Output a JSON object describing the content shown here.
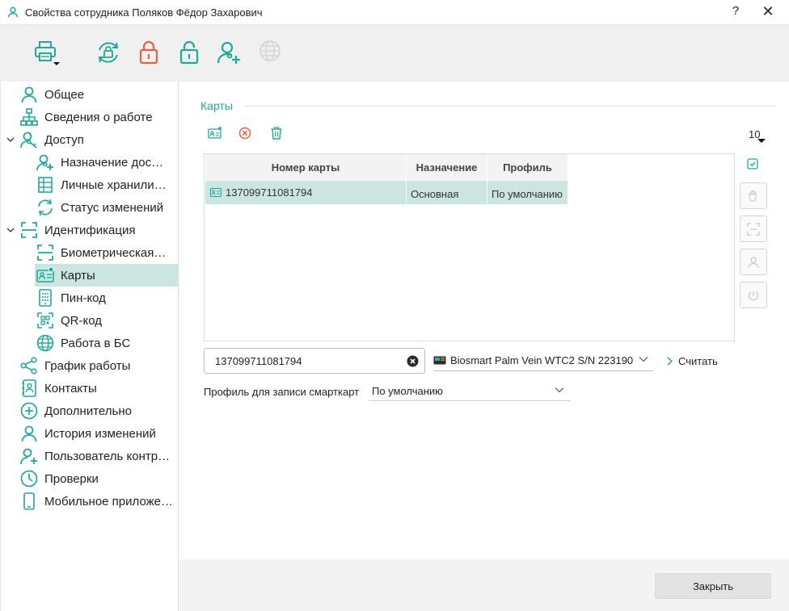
{
  "window": {
    "title": "Свойства сотрудника Поляков Фёдор Захарович",
    "help": "?",
    "close": "✕"
  },
  "colors": {
    "accent": "#1fa99b",
    "danger": "#e8603c",
    "selection": "#cbe6e1"
  },
  "toolbar": {
    "buttons": [
      {
        "name": "print",
        "icon": "printer-icon",
        "enabled": true
      },
      {
        "name": "sync-lock",
        "icon": "sync-lock-icon",
        "enabled": true
      },
      {
        "name": "lock",
        "icon": "lock-icon",
        "enabled": true
      },
      {
        "name": "unlock",
        "icon": "unlock-icon",
        "enabled": true
      },
      {
        "name": "add-access",
        "icon": "user-add-icon",
        "enabled": true
      },
      {
        "name": "web",
        "icon": "globe-icon",
        "enabled": false
      }
    ]
  },
  "sidebar": {
    "items": [
      {
        "label": "Общее",
        "icon": "user-icon"
      },
      {
        "label": "Сведения о работе",
        "icon": "org-chart-icon"
      },
      {
        "label": "Доступ",
        "icon": "access-icon",
        "expanded": true
      },
      {
        "label": "Назначение доступа",
        "icon": "access-assign-icon"
      },
      {
        "label": "Личные хранилища",
        "icon": "storage-icon"
      },
      {
        "label": "Статус изменений",
        "icon": "refresh-icon"
      },
      {
        "label": "Идентификация",
        "icon": "scan-icon",
        "expanded": true
      },
      {
        "label": "Биометрическая идентификация",
        "icon": "scan-icon"
      },
      {
        "label": "Карты",
        "icon": "card-icon",
        "selected": true
      },
      {
        "label": "Пин-код",
        "icon": "pin-icon"
      },
      {
        "label": "QR-код",
        "icon": "qr-icon"
      },
      {
        "label": "Работа в БС",
        "icon": "globe-icon"
      },
      {
        "label": "График работы",
        "icon": "share-icon"
      },
      {
        "label": "Контакты",
        "icon": "contacts-icon"
      },
      {
        "label": "Дополнительно",
        "icon": "plus-circle-icon"
      },
      {
        "label": "История изменений",
        "icon": "user-icon"
      },
      {
        "label": "Пользователь контроллера",
        "icon": "user-add-icon"
      },
      {
        "label": "Проверки",
        "icon": "clock-icon"
      },
      {
        "label": "Мобильное приложение",
        "icon": "phone-icon"
      }
    ]
  },
  "main": {
    "section_title": "Карты",
    "page_size": "10",
    "table": {
      "columns": [
        "Номер карты",
        "Назначение",
        "Профиль"
      ],
      "rows": [
        {
          "number": "137099711081794",
          "purpose": "Основная",
          "profile": "По умолчанию"
        }
      ]
    },
    "card_input": {
      "value": "137099711081794"
    },
    "reader": {
      "value": "Biosmart Palm Vein WTC2 S/N 223190"
    },
    "read_button": "Считать",
    "profile_label": "Профиль для записи смарткарт",
    "profile_value": "По умолчанию"
  },
  "footer": {
    "close_label": "Закрыть"
  }
}
